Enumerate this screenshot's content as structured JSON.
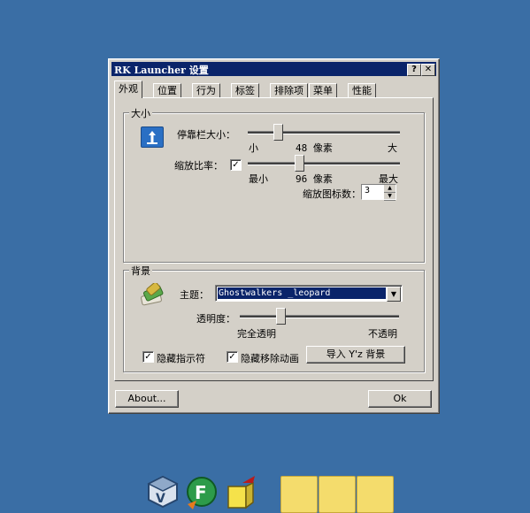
{
  "window": {
    "title": "RK Launcher 设置",
    "help_btn": "?",
    "close_btn": "✕"
  },
  "tabs": [
    "外观",
    "位置",
    "行为",
    "标签",
    "排除项",
    "菜单",
    "性能"
  ],
  "size_group": {
    "title": "大小",
    "dock_size_label": "停靠栏大小：",
    "dock_size_min": "小",
    "dock_size_value": "48 像素",
    "dock_size_max": "大",
    "dock_size_fraction": 0.18,
    "zoom_label": "缩放比率：",
    "zoom_checked": true,
    "zoom_min": "最小",
    "zoom_value": "96 像素",
    "zoom_max": "最大",
    "zoom_fraction": 0.33,
    "zoom_icons_label": "缩放图标数：",
    "zoom_icons_value": "3"
  },
  "bg_group": {
    "title": "背景",
    "theme_label": "主题：",
    "theme_value": "Ghostwalkers _leopard",
    "opacity_label": "透明度：",
    "opacity_min": "完全透明",
    "opacity_max": "不透明",
    "opacity_fraction": 0.24,
    "hide_indicator_label": "隐藏指示符",
    "hide_indicator_checked": true,
    "hide_anim_label": "隐藏移除动画",
    "hide_anim_checked": true,
    "import_btn": "导入 Y'z 背景"
  },
  "footer": {
    "about_btn": "About...",
    "ok_btn": "Ok"
  },
  "colors": {
    "desktop": "#3a6ea5",
    "titlebar": "#0a246a",
    "face": "#d4d0c8"
  }
}
